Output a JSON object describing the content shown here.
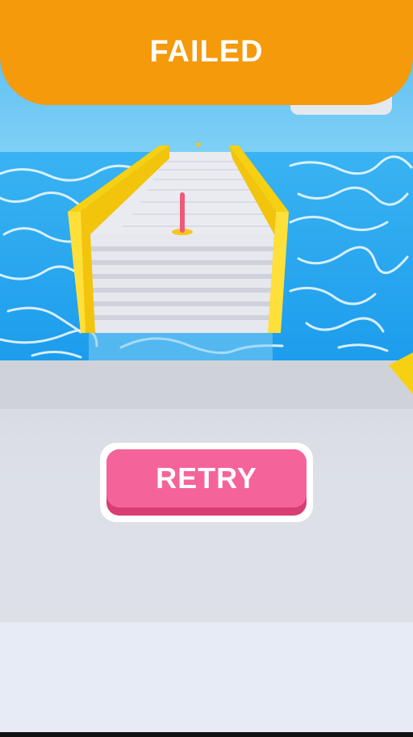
{
  "banner": {
    "text": "FAILED",
    "color": "#f59a0b"
  },
  "retry_button": {
    "label": "RETRY",
    "color": "#f4649a",
    "shadow_color": "#d93e72"
  },
  "colors": {
    "water": "#1fa3ee",
    "track": "#e3e6ee",
    "rails": "#f7d012",
    "pole": "#f05a7a"
  }
}
